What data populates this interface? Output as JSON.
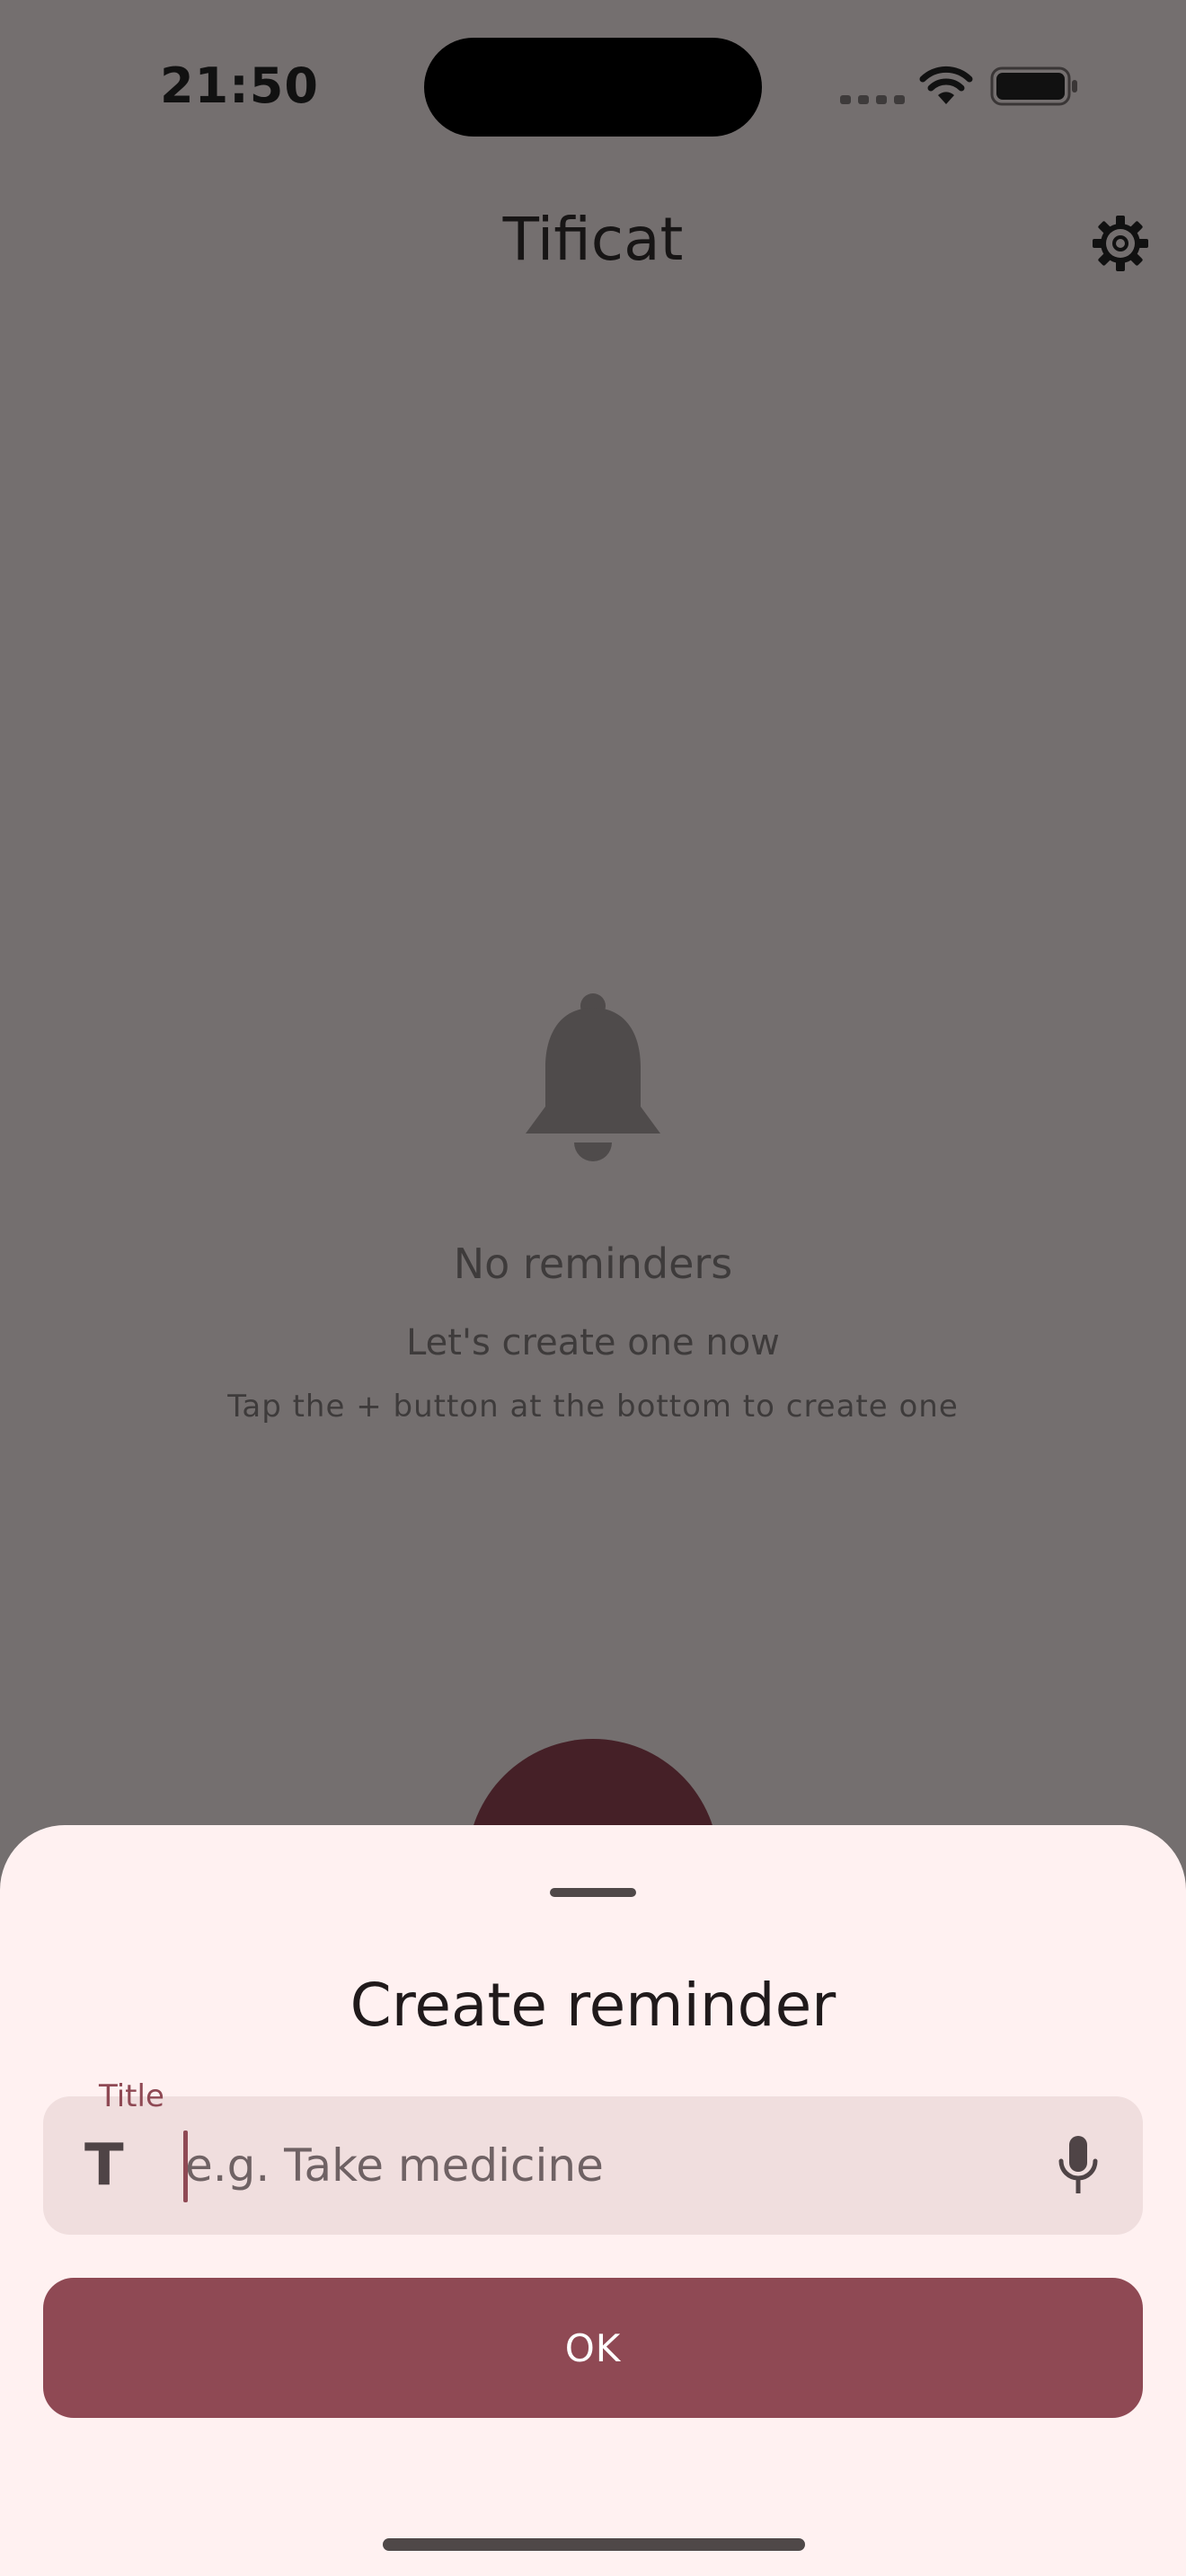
{
  "status_bar": {
    "time": "21:50",
    "icons": [
      "signal-dots-icon",
      "wifi-icon",
      "battery-icon"
    ]
  },
  "app_bar": {
    "title": "Tificat",
    "settings_icon": "gear-icon"
  },
  "empty_state": {
    "icon": "bell-icon",
    "title": "No reminders",
    "subtitle": "Let's create one now",
    "hint": "Tap the + button at the bottom to create one"
  },
  "sheet": {
    "title": "Create reminder",
    "title_field": {
      "label": "Title",
      "value": "",
      "placeholder": "e.g. Take medicine",
      "leading_icon": "text-title-icon",
      "leading_glyph": "T",
      "trailing_icon": "microphone-icon"
    },
    "ok_label": "OK"
  },
  "colors": {
    "scrim_background": "#746f6f",
    "sheet_background": "#fff1f1",
    "field_background": "#f0dede",
    "primary": "#8f4954",
    "fab": "#452027"
  }
}
